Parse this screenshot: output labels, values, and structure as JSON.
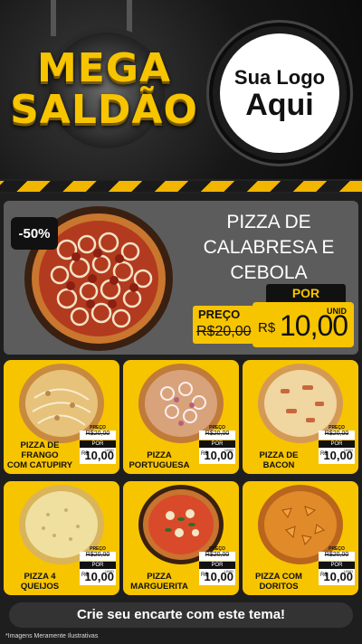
{
  "header": {
    "line1": "MEGA",
    "line2": "SALDÃO",
    "logo_line1": "Sua Logo",
    "logo_line2": "Aqui"
  },
  "feature": {
    "discount": "-50%",
    "title_lines": [
      "PIZZA DE",
      "CALABRESA E",
      "CEBOLA"
    ],
    "por_label": "POR",
    "preco_label": "PREÇO",
    "old_price": "R$20,00",
    "currency": "R$",
    "new_price": "10,00",
    "unit": "UNID"
  },
  "cards": [
    {
      "name_lines": [
        "PIZZA DE FRANGO",
        "COM CATUPIRY"
      ],
      "old": "R$20,00",
      "new": "10,00"
    },
    {
      "name_lines": [
        "PIZZA",
        "PORTUGUESA"
      ],
      "old": "R$20,00",
      "new": "10,00"
    },
    {
      "name_lines": [
        "PIZZA DE",
        "BACON"
      ],
      "old": "R$20,00",
      "new": "10,00"
    },
    {
      "name_lines": [
        "PIZZA 4",
        "QUEIJOS"
      ],
      "old": "R$20,00",
      "new": "10,00"
    },
    {
      "name_lines": [
        "PIZZA",
        "MARGUERITA"
      ],
      "old": "R$20,00",
      "new": "10,00"
    },
    {
      "name_lines": [
        "PIZZA COM",
        "DORITOS"
      ],
      "old": "R$20,00",
      "new": "10,00"
    }
  ],
  "mini": {
    "preco_label": "PREÇO",
    "por_label": "POR",
    "currency": "R$",
    "unit": "UNID"
  },
  "footer": {
    "cta": "Crie seu encarte com este tema!",
    "disclaimer": "*Imagens Meramente Ilustrativas"
  },
  "colors": {
    "accent": "#f7c400",
    "dark": "#111111",
    "feature_bg": "#5c5c5c"
  }
}
